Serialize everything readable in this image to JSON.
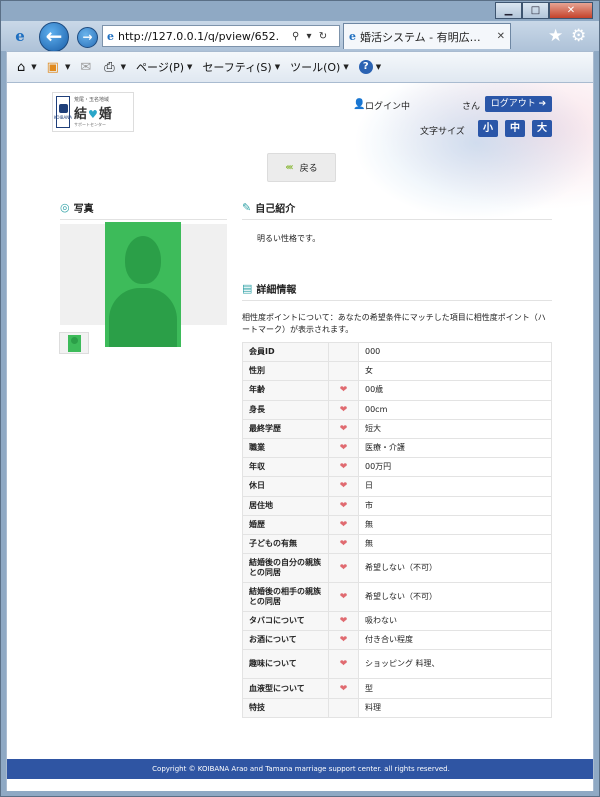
{
  "browser": {
    "url": "http://127.0.0.1/q/pview/652.",
    "tab_title": "婚活システム - 有明広…",
    "toolbar": {
      "page": "ページ(P)",
      "safety": "セーフティ(S)",
      "tools": "ツール(O)"
    }
  },
  "header": {
    "logo_sub": "荒尾・玉名地域",
    "logo_main_left": "結",
    "logo_main_right": "婚",
    "logo_tag": "サポートセンター",
    "logo_seal": "KOIBANA",
    "login_status": "ログイン中",
    "user_suffix": "さん",
    "logout_label": "ログアウト",
    "font_size_label": "文字サイズ",
    "font_sizes": [
      "小",
      "中",
      "大"
    ]
  },
  "back_label": "戻る",
  "sections": {
    "photo": "写真",
    "self_intro": "自己紹介",
    "details": "詳細情報"
  },
  "self_intro_text": "明るい性格です。",
  "match_notice": "相性度ポイントについて：あなたの希望条件にマッチした項目に相性度ポイント（ハートマーク）が表示されます。",
  "details": [
    {
      "label": "会員ID",
      "heart": false,
      "value": "000"
    },
    {
      "label": "性別",
      "heart": false,
      "value": "女"
    },
    {
      "label": "年齢",
      "heart": true,
      "value": "00歳"
    },
    {
      "label": "身長",
      "heart": true,
      "value": "00cm"
    },
    {
      "label": "最終学歴",
      "heart": true,
      "value": "短大"
    },
    {
      "label": "職業",
      "heart": true,
      "value": "医療・介護"
    },
    {
      "label": "年収",
      "heart": true,
      "value": "00万円"
    },
    {
      "label": "休日",
      "heart": true,
      "value": "日"
    },
    {
      "label": "居住地",
      "heart": true,
      "value": "市"
    },
    {
      "label": "婚歴",
      "heart": true,
      "value": "無"
    },
    {
      "label": "子どもの有無",
      "heart": true,
      "value": "無"
    },
    {
      "label": "結婚後の自分の親族との同居",
      "heart": true,
      "value": "希望しない（不可）"
    },
    {
      "label": "結婚後の相手の親族との同居",
      "heart": true,
      "value": "希望しない（不可）"
    },
    {
      "label": "タバコについて",
      "heart": true,
      "value": "吸わない"
    },
    {
      "label": "お酒について",
      "heart": true,
      "value": "付き合い程度"
    },
    {
      "label": "趣味について",
      "heart": true,
      "value": "ショッピング 料理、"
    },
    {
      "label": "血液型について",
      "heart": true,
      "value": "型"
    },
    {
      "label": "特技",
      "heart": false,
      "value": "料理"
    }
  ],
  "footer": "Copyright © KOIBANA Arao and Tamana marriage support center. all rights reserved.",
  "colors": {
    "accent_blue": "#2a56a8",
    "footer_blue": "#2f55a3",
    "heart_pink": "#e06a70",
    "avatar_green": "#3dbb5a"
  }
}
